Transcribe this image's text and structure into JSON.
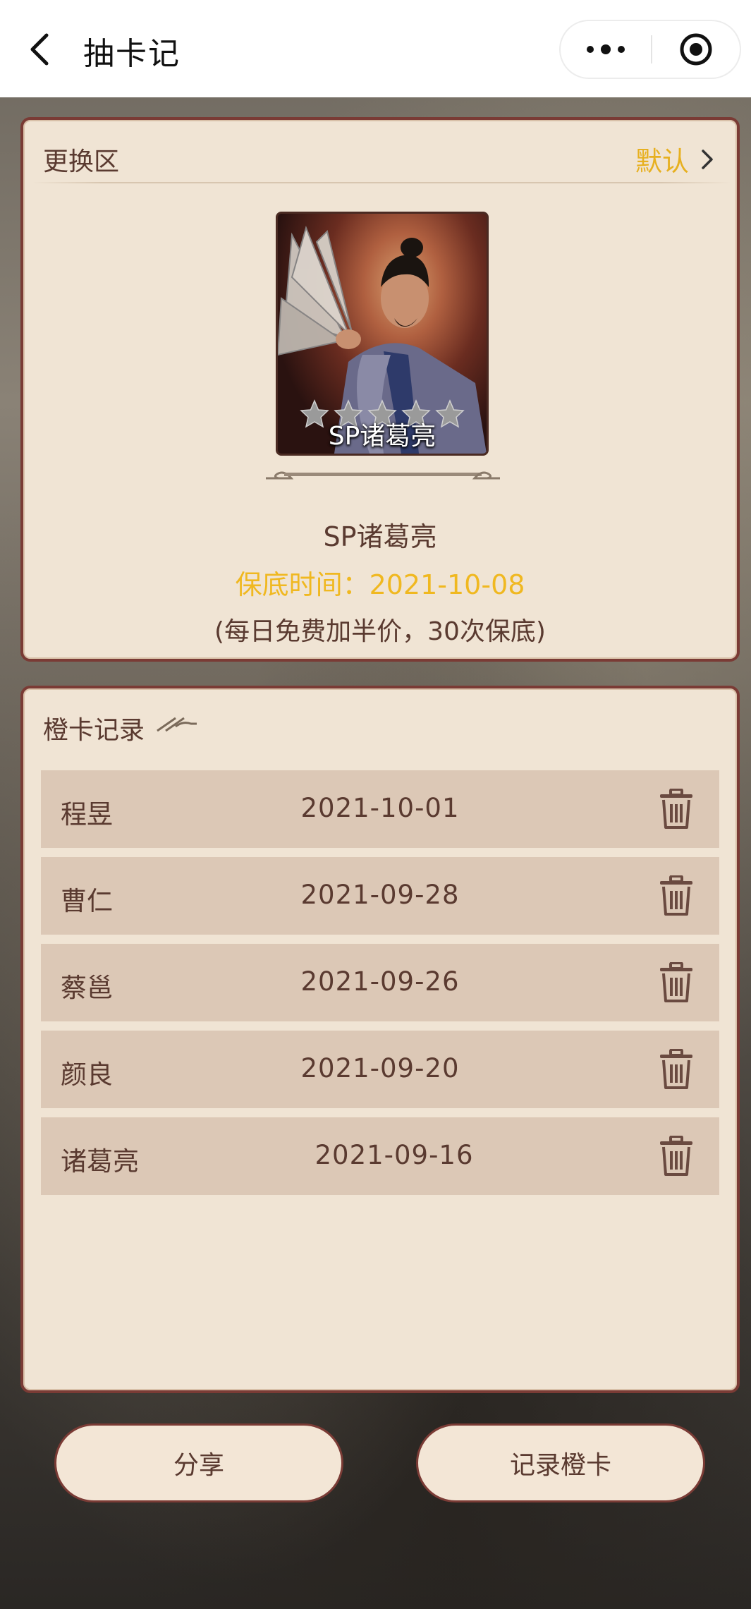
{
  "nav": {
    "title": "抽卡记",
    "back_icon": "chevron-left-icon",
    "more_icon": "more-dots-icon",
    "close_icon": "target-close-icon"
  },
  "swap_section": {
    "title": "更换区",
    "default_label": "默认",
    "card": {
      "name": "SP诸葛亮",
      "stars": 5
    },
    "hero_name": "SP诸葛亮",
    "guarantee_text": "保底时间：2021-10-08",
    "note": "(每日免费加半价，30次保底)"
  },
  "records_section": {
    "title": "橙卡记录",
    "rows": [
      {
        "name": "程昱",
        "date": "2021-10-01"
      },
      {
        "name": "曹仁",
        "date": "2021-09-28"
      },
      {
        "name": "蔡邕",
        "date": "2021-09-26"
      },
      {
        "name": "颜良",
        "date": "2021-09-20"
      },
      {
        "name": "诸葛亮",
        "date": "2021-09-16"
      }
    ]
  },
  "buttons": {
    "share": "分享",
    "record": "记录橙卡"
  },
  "colors": {
    "accent_gold": "#e7b020",
    "panel_bg": "#f0e4d4",
    "panel_border": "#7a3b35",
    "row_bg": "#dcc8b6",
    "text_brown": "#5a3a30"
  }
}
